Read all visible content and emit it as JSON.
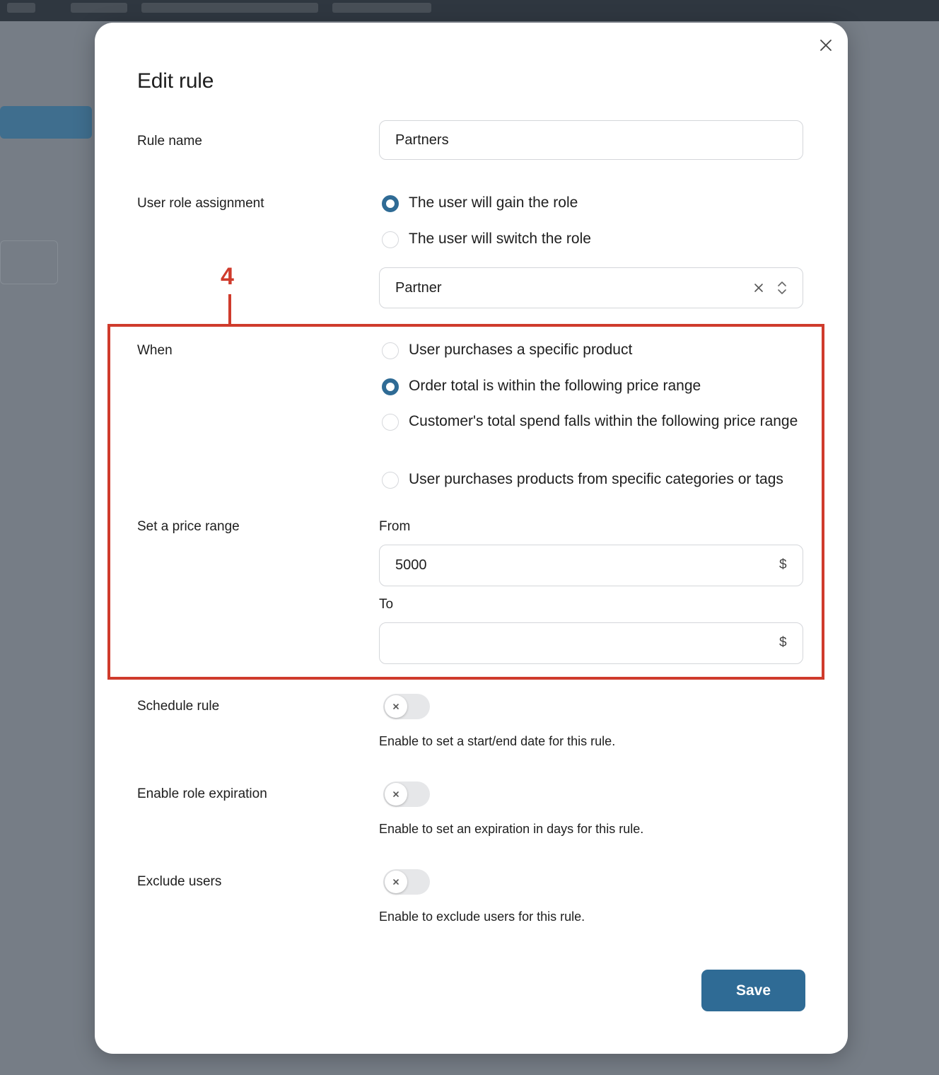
{
  "modal": {
    "title": "Edit rule",
    "save_label": "Save"
  },
  "rule_name": {
    "label": "Rule name",
    "value": "Partners"
  },
  "role_assignment": {
    "label": "User role assignment",
    "options": [
      {
        "label": "The user will gain the role",
        "checked": true
      },
      {
        "label": "The user will switch the role",
        "checked": false
      }
    ],
    "selected_role": "Partner"
  },
  "callout": {
    "number": "4"
  },
  "when": {
    "label": "When",
    "options": [
      {
        "label": "User purchases a specific product",
        "checked": false
      },
      {
        "label": "Order total is within the following price range",
        "checked": true
      },
      {
        "label": "Customer's total spend falls within the following price range",
        "checked": false
      },
      {
        "label": "User purchases products from specific categories or tags",
        "checked": false
      }
    ]
  },
  "price_range": {
    "label": "Set a price range",
    "from_label": "From",
    "from_value": "5000",
    "to_label": "To",
    "to_value": "",
    "currency": "$"
  },
  "schedule": {
    "label": "Schedule rule",
    "help": "Enable to set a start/end date for this rule.",
    "enabled": false
  },
  "expiration": {
    "label": "Enable role expiration",
    "help": "Enable to set an expiration in days for this rule.",
    "enabled": false
  },
  "exclude": {
    "label": "Exclude users",
    "help": "Enable to exclude users for this rule.",
    "enabled": false
  },
  "colors": {
    "accent": "#2f6b95",
    "highlight": "#cf3b2c"
  }
}
